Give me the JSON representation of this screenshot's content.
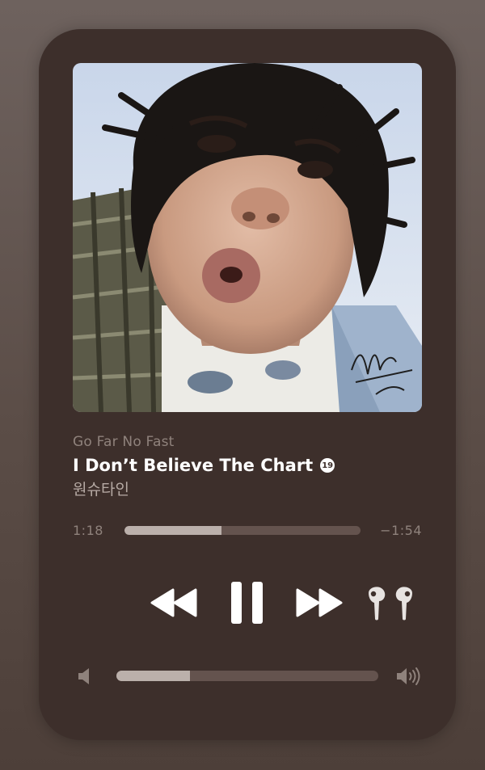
{
  "player": {
    "album": "Go Far No Fast",
    "title": "I Don’t Believe The Chart",
    "explicit_badge": "19",
    "artist": "원슈타인",
    "elapsed": "1:18",
    "remaining": "−1:54",
    "progress_fraction": 0.41,
    "volume_fraction": 0.28
  },
  "controls": {
    "rewind_icon": "backward-icon",
    "pause_icon": "pause-icon",
    "forward_icon": "forward-icon",
    "airpods_icon": "airpods-pro-icon",
    "volume_low_icon": "speaker-low-icon",
    "volume_high_icon": "speaker-high-icon"
  },
  "colors": {
    "card_background": "#3d2f2b",
    "track_background": "#64534e",
    "track_fill": "#bbb0ab",
    "primary_text": "#ffffff",
    "secondary_text": "#8f827c"
  }
}
